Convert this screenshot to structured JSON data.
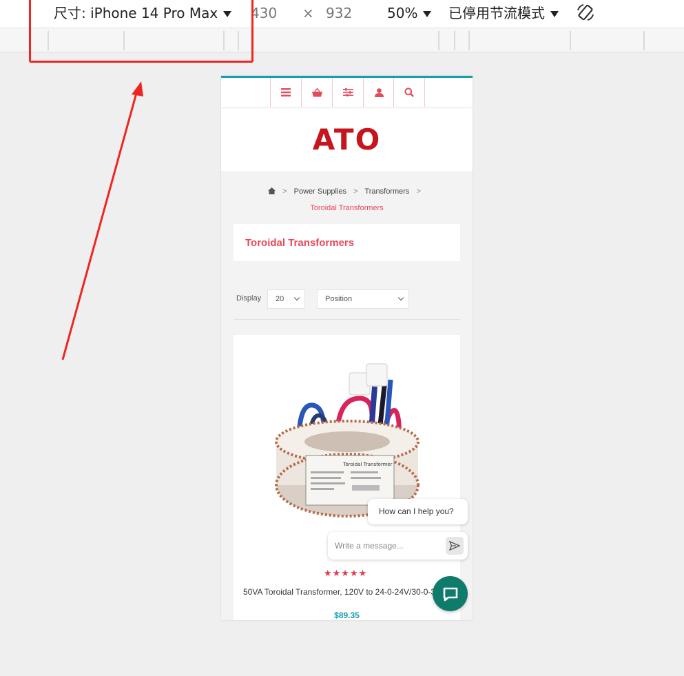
{
  "devtools": {
    "device_label": "尺寸: iPhone 14 Pro Max",
    "width": "430",
    "times": "×",
    "height": "932",
    "zoom": "50%",
    "throttle": "已停用节流模式",
    "rotate_icon": "rotate-icon"
  },
  "colors": {
    "accent_pink": "#e64a5a",
    "logo_red": "#c4161c",
    "teal": "#13a0b0",
    "chat_green": "#0f7b6a",
    "highlight_red": "#f0251f"
  },
  "site": {
    "nav_icons": [
      "menu-icon",
      "cart-icon",
      "filter-icon",
      "account-icon",
      "search-icon"
    ],
    "logo": "ATO",
    "breadcrumb": {
      "items": [
        "Power Supplies",
        "Transformers"
      ],
      "current": "Toroidal Transformers"
    },
    "category_title": "Toroidal Transformers",
    "toolbar": {
      "display_label": "Display",
      "display_value": "20",
      "sort_value": "Position"
    },
    "product": {
      "image_label": "Toroidal Transformer",
      "rating_stars": "★★★★★",
      "rating": 5,
      "name": "50VA Toroidal Transformer, 120V to 24-0-24V/30-0-30V",
      "price": "$89.35"
    },
    "chat": {
      "greeting": "How can I help you?",
      "input_placeholder": "Write a message..."
    }
  }
}
